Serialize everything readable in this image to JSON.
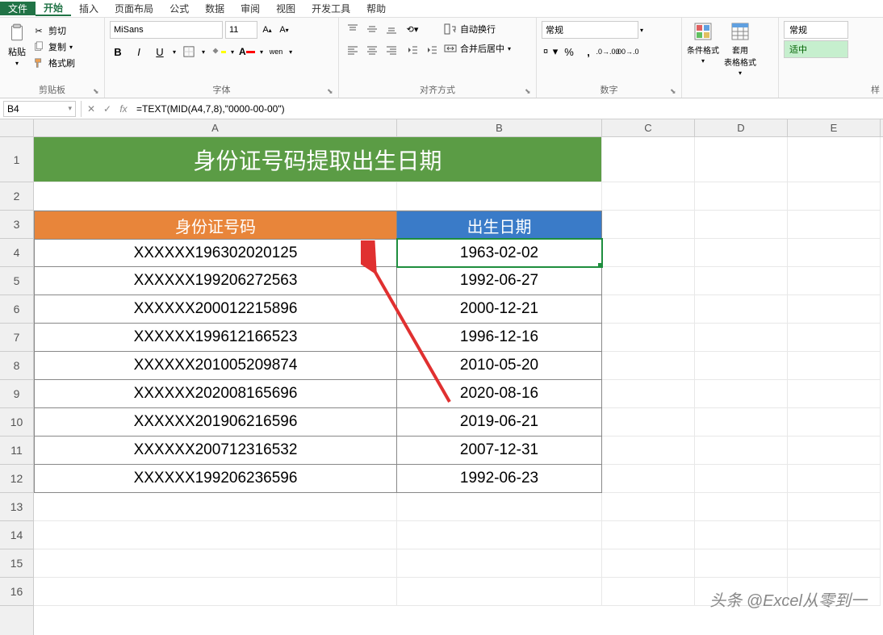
{
  "menu": {
    "file": "文件",
    "home": "开始",
    "insert": "插入",
    "layout": "页面布局",
    "formulas": "公式",
    "data": "数据",
    "review": "审阅",
    "view": "视图",
    "dev": "开发工具",
    "help": "帮助"
  },
  "ribbon": {
    "clipboard": {
      "label": "剪贴板",
      "paste": "粘贴",
      "cut": "剪切",
      "copy": "复制",
      "format_painter": "格式刷"
    },
    "font": {
      "label": "字体",
      "name": "MiSans",
      "size": "11",
      "bold": "B",
      "italic": "I",
      "underline": "U",
      "wen": "wen"
    },
    "align": {
      "label": "对齐方式",
      "wrap": "自动换行",
      "merge": "合并后居中"
    },
    "number": {
      "label": "数字",
      "format": "常规"
    },
    "styles": {
      "label": "样",
      "cond": "条件格式",
      "table": "套用\n表格格式",
      "normal": "常规",
      "good": "适中"
    }
  },
  "formula_bar": {
    "cell_ref": "B4",
    "formula": "=TEXT(MID(A4,7,8),\"0000-00-00\")"
  },
  "columns": [
    "A",
    "B",
    "C",
    "D",
    "E"
  ],
  "row_numbers": [
    "1",
    "2",
    "3",
    "4",
    "5",
    "6",
    "7",
    "8",
    "9",
    "10",
    "11",
    "12",
    "13",
    "14",
    "15",
    "16"
  ],
  "title": "身份证号码提取出生日期",
  "headers": {
    "a": "身份证号码",
    "b": "出生日期"
  },
  "rows": [
    {
      "id": "XXXXXX196302020125",
      "date": "1963-02-02"
    },
    {
      "id": "XXXXXX199206272563",
      "date": "1992-06-27"
    },
    {
      "id": "XXXXXX200012215896",
      "date": "2000-12-21"
    },
    {
      "id": "XXXXXX199612166523",
      "date": "1996-12-16"
    },
    {
      "id": "XXXXXX201005209874",
      "date": "2010-05-20"
    },
    {
      "id": "XXXXXX202008165696",
      "date": "2020-08-16"
    },
    {
      "id": "XXXXXX201906216596",
      "date": "2019-06-21"
    },
    {
      "id": "XXXXXX200712316532",
      "date": "2007-12-31"
    },
    {
      "id": "XXXXXX199206236596",
      "date": "1992-06-23"
    }
  ],
  "watermark": "头条 @Excel从零到一"
}
